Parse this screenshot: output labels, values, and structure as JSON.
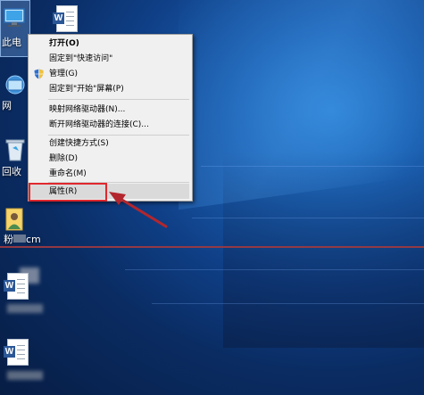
{
  "desktop_icons": {
    "this_pc": {
      "label": "此电"
    },
    "network": {
      "label": "网"
    },
    "recycle": {
      "label": "回收"
    },
    "user_file": {
      "label": "粉",
      "label_suffix": "cm"
    }
  },
  "context_menu": {
    "items": [
      {
        "label": "打开(O)"
      },
      {
        "label": "固定到\"快速访问\""
      },
      {
        "label": "管理(G)"
      },
      {
        "label": "固定到\"开始\"屏幕(P)"
      },
      {
        "label": "映射网络驱动器(N)..."
      },
      {
        "label": "断开网络驱动器的连接(C)..."
      },
      {
        "label": "创建快捷方式(S)"
      },
      {
        "label": "删除(D)"
      },
      {
        "label": "重命名(M)"
      },
      {
        "label": "属性(R)"
      }
    ]
  },
  "colors": {
    "highlight_border": "#e0282e",
    "arrow": "#b3262d",
    "red_line": "#a13a3f"
  }
}
